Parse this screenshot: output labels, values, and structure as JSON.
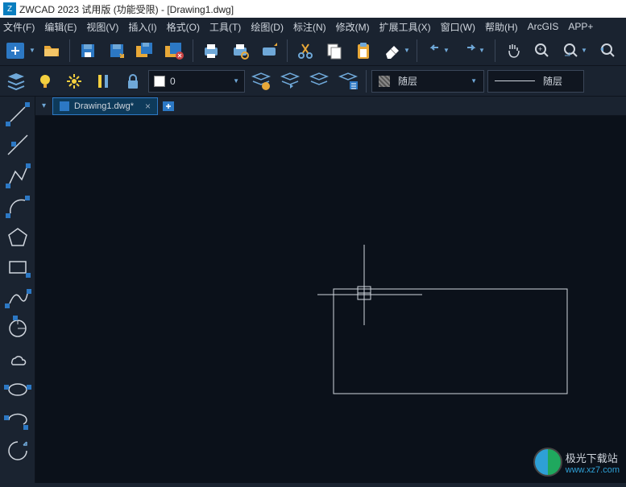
{
  "title": "ZWCAD 2023 试用版 (功能受限) - [Drawing1.dwg]",
  "menu": {
    "file": "文件(F)",
    "edit": "编辑(E)",
    "view": "视图(V)",
    "insert": "插入(I)",
    "format": "格式(O)",
    "tools": "工具(T)",
    "draw": "绘图(D)",
    "dimension": "标注(N)",
    "modify": "修改(M)",
    "extension": "扩展工具(X)",
    "window": "窗口(W)",
    "help": "帮助(H)",
    "arcgis": "ArcGIS",
    "appplus": "APP+"
  },
  "layer": {
    "current": "0"
  },
  "linetype": {
    "current": "随层"
  },
  "lineweight": {
    "current": "随层"
  },
  "tab": {
    "filename": "Drawing1.dwg*"
  },
  "watermark": {
    "brand": "极光下载站",
    "url": "www.xz7.com"
  },
  "colors": {
    "accent": "#2c78c4",
    "bg": "#1a2330",
    "canvas": "#0b111a"
  }
}
